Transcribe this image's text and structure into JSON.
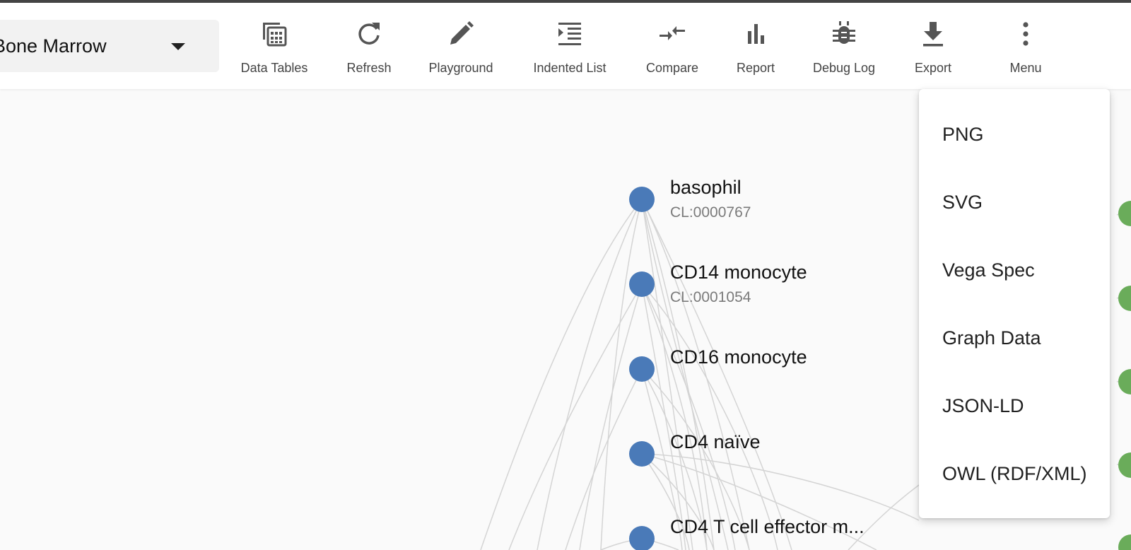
{
  "organ_select": {
    "value": "Bone Marrow"
  },
  "toolbar": {
    "buttons": [
      {
        "id": "data-tables",
        "label": "Data Tables",
        "icon": "table-icon"
      },
      {
        "id": "refresh",
        "label": "Refresh",
        "icon": "refresh-icon"
      },
      {
        "id": "playground",
        "label": "Playground",
        "icon": "pencil-icon"
      },
      {
        "id": "indented-list",
        "label": "Indented List",
        "icon": "indent-icon"
      },
      {
        "id": "compare",
        "label": "Compare",
        "icon": "compare-arrows-icon"
      },
      {
        "id": "report",
        "label": "Report",
        "icon": "bar-chart-icon"
      },
      {
        "id": "debug-log",
        "label": "Debug Log",
        "icon": "bug-icon"
      },
      {
        "id": "export",
        "label": "Export",
        "icon": "download-icon"
      },
      {
        "id": "menu",
        "label": "Menu",
        "icon": "more-vert-icon"
      }
    ]
  },
  "graph": {
    "nodes": [
      {
        "label": "basophil",
        "id": "CL:0000767"
      },
      {
        "label": "CD14 monocyte",
        "id": "CL:0001054"
      },
      {
        "label": "CD16 monocyte",
        "id": ""
      },
      {
        "label": "CD4 naïve",
        "id": ""
      },
      {
        "label": "CD4 T cell effector m...",
        "id": ""
      }
    ]
  },
  "export_menu": {
    "items": [
      "PNG",
      "SVG",
      "Vega Spec",
      "Graph Data",
      "JSON-LD",
      "OWL (RDF/XML)"
    ]
  },
  "colors": {
    "node_blue": "#4a7ab8",
    "node_green": "#6aac5a",
    "edge": "#d0d0d0"
  }
}
